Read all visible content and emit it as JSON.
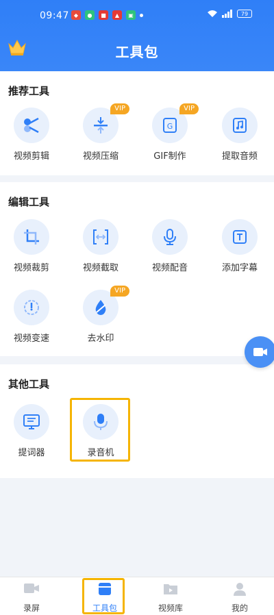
{
  "status": {
    "time": "09:47",
    "battery": "79"
  },
  "header": {
    "title": "工具包"
  },
  "sections": [
    {
      "title": "推荐工具",
      "tools": [
        {
          "label": "视频剪辑",
          "icon": "scissors-icon",
          "vip": false
        },
        {
          "label": "视频压缩",
          "icon": "compress-icon",
          "vip": true
        },
        {
          "label": "GIF制作",
          "icon": "gif-icon",
          "vip": true
        },
        {
          "label": "提取音频",
          "icon": "music-icon",
          "vip": false
        }
      ]
    },
    {
      "title": "编辑工具",
      "tools": [
        {
          "label": "视频裁剪",
          "icon": "crop-icon",
          "vip": false
        },
        {
          "label": "视频截取",
          "icon": "trim-icon",
          "vip": false
        },
        {
          "label": "视频配音",
          "icon": "microphone-icon",
          "vip": false
        },
        {
          "label": "添加字幕",
          "icon": "subtitle-icon",
          "vip": false
        },
        {
          "label": "视频变速",
          "icon": "speed-icon",
          "vip": false
        },
        {
          "label": "去水印",
          "icon": "watermark-icon",
          "vip": true
        }
      ]
    },
    {
      "title": "其他工具",
      "tools": [
        {
          "label": "提词器",
          "icon": "teleprompter-icon",
          "vip": false
        },
        {
          "label": "录音机",
          "icon": "recorder-icon",
          "vip": false
        }
      ]
    }
  ],
  "vip_label": "VIP",
  "bottom_nav": [
    {
      "label": "录屏",
      "icon": "camera-icon",
      "active": false
    },
    {
      "label": "工具包",
      "icon": "toolbox-icon",
      "active": true
    },
    {
      "label": "视频库",
      "icon": "folder-icon",
      "active": false
    },
    {
      "label": "我的",
      "icon": "profile-icon",
      "active": false
    }
  ],
  "colors": {
    "primary": "#2f7ff7",
    "vip": "#f5a623",
    "highlight": "#f5b400",
    "icon_bg": "#e8f0fc"
  }
}
